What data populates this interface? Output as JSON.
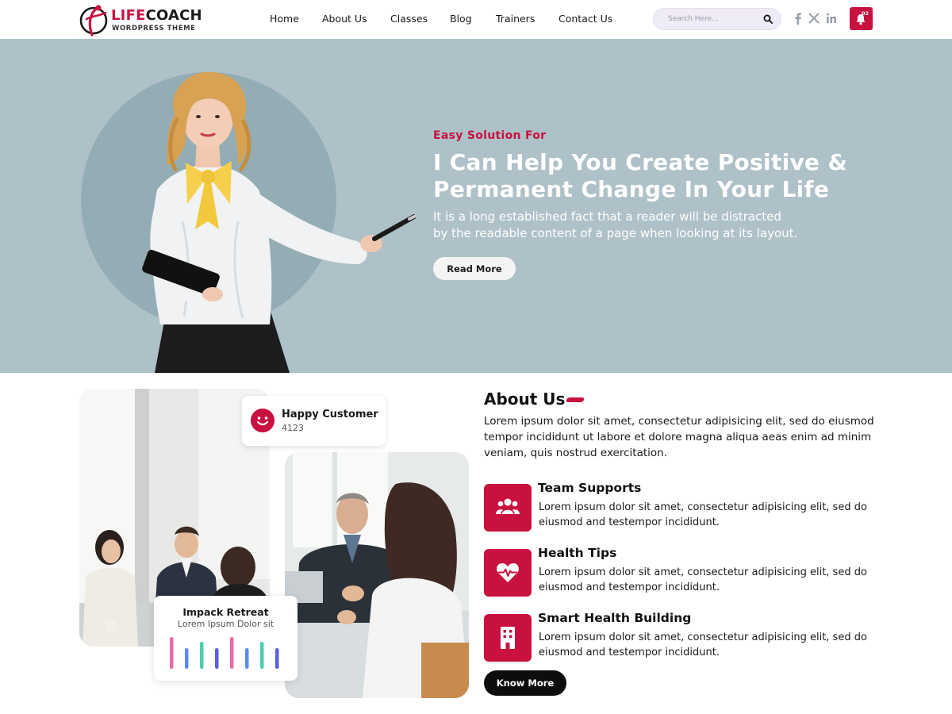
{
  "brand": {
    "name_part1": "LIFE",
    "name_part2": "COACH",
    "tagline": "WORDPRESS THEME",
    "accent_color": "#c8113f"
  },
  "nav": {
    "items": [
      {
        "label": "Home"
      },
      {
        "label": "About Us"
      },
      {
        "label": "Classes"
      },
      {
        "label": "Blog"
      },
      {
        "label": "Trainers"
      },
      {
        "label": "Contact Us"
      }
    ]
  },
  "search": {
    "placeholder": "Search Here...",
    "icon": "search-icon"
  },
  "social": [
    "facebook-icon",
    "x-twitter-icon",
    "linkedin-icon"
  ],
  "notifications": {
    "count": "02",
    "icon": "bell-icon"
  },
  "hero": {
    "eyebrow": "Easy Solution For",
    "title_line1": "I Can Help You Create Positive &",
    "title_line2": "Permanent Change In Your Life",
    "desc_line1": "It is a long established fact that a reader will be distracted",
    "desc_line2": "by the readable content of a page when looking at its layout.",
    "button": "Read More",
    "background_color": "#aec1c8"
  },
  "stats": {
    "happy_title": "Happy Customer",
    "happy_count": "4123",
    "impact_title": "Impack Retreat",
    "impact_sub": "Lorem Ipsum Dolor sit"
  },
  "about": {
    "title": "About Us",
    "desc": "Lorem ipsum dolor sit amet, consectetur adipisicing elit, sed do eiusmod tempor incididunt ut labore et dolore magna aliqua aeas enim ad minim veniam, quis nostrud exercitation.",
    "features": [
      {
        "icon": "team-icon",
        "title": "Team Supports",
        "desc": "Lorem ipsum dolor sit amet, consectetur adipisicing elit, sed do eiusmod and testempor incididunt."
      },
      {
        "icon": "heart-pulse-icon",
        "title": "Health Tips",
        "desc": "Lorem ipsum dolor sit amet, consectetur adipisicing elit, sed do eiusmod and testempor incididunt."
      },
      {
        "icon": "building-icon",
        "title": "Smart Health Building",
        "desc": "Lorem ipsum dolor sit amet, consectetur adipisicing elit, sed do eiusmod and testempor incididunt."
      }
    ],
    "button": "Know More"
  }
}
